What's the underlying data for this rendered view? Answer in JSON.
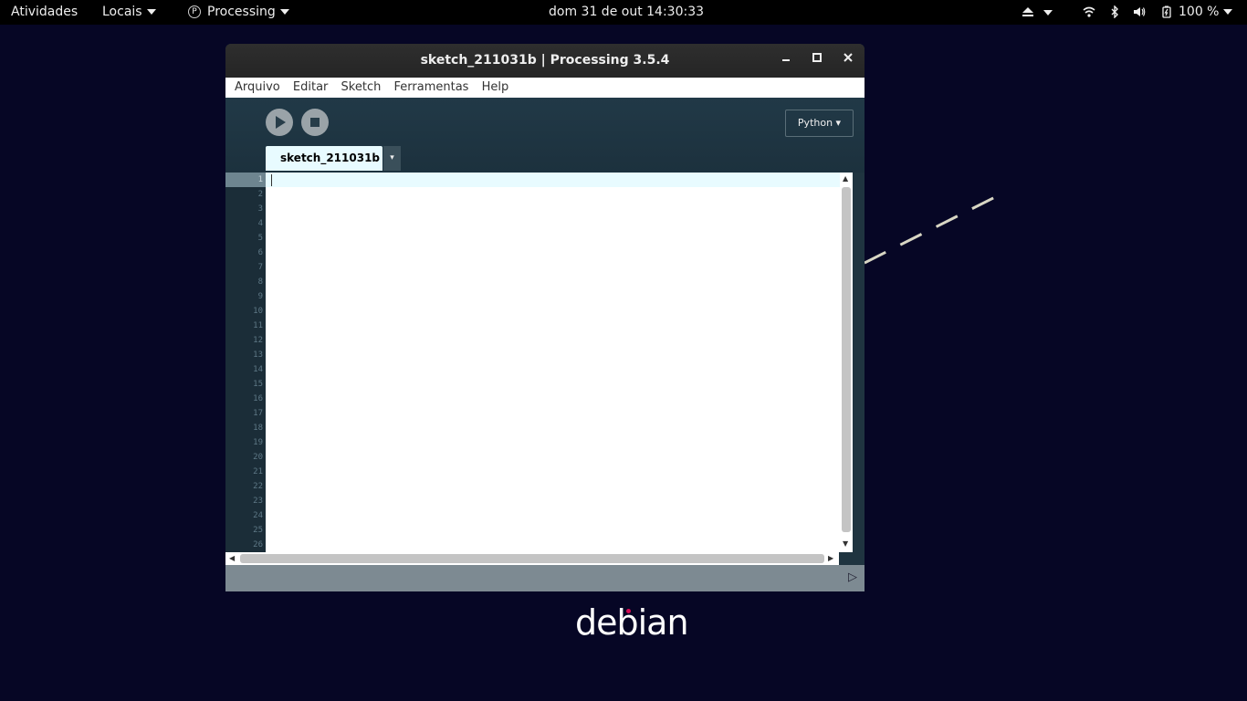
{
  "topbar": {
    "activities": "Atividades",
    "places": "Locais",
    "app_icon": "P",
    "app_name": "Processing",
    "clock": "dom 31 de out  14:30:33",
    "battery": "100 %"
  },
  "window": {
    "title": "sketch_211031b | Processing 3.5.4",
    "menu": [
      "Arquivo",
      "Editar",
      "Sketch",
      "Ferramentas",
      "Help"
    ],
    "mode": "Python ▾",
    "tab_label": "sketch_211031b",
    "tab_menu_glyph": "▾",
    "line_numbers": [
      "1",
      "2",
      "3",
      "4",
      "5",
      "6",
      "7",
      "8",
      "9",
      "10",
      "11",
      "12",
      "13",
      "14",
      "15",
      "16",
      "17",
      "18",
      "19",
      "20",
      "21",
      "22",
      "23",
      "24",
      "25",
      "26"
    ],
    "console_toggle": "▷"
  },
  "desktop": {
    "logo_text": "debian"
  },
  "icons": {
    "minimize": "minimize-icon",
    "maximize": "maximize-icon",
    "close": "close-icon",
    "run": "play-icon",
    "stop": "stop-icon",
    "wifi": "wifi-icon",
    "bluetooth": "bluetooth-icon",
    "volume": "volume-icon",
    "battery": "battery-icon",
    "eject": "eject-icon"
  },
  "colors": {
    "desktop_bg": "#060625",
    "editor_bg": "#ffffff",
    "toolbar_bg": "#213947",
    "current_line": "#e8fbff",
    "debian_accent": "#d70a53"
  }
}
